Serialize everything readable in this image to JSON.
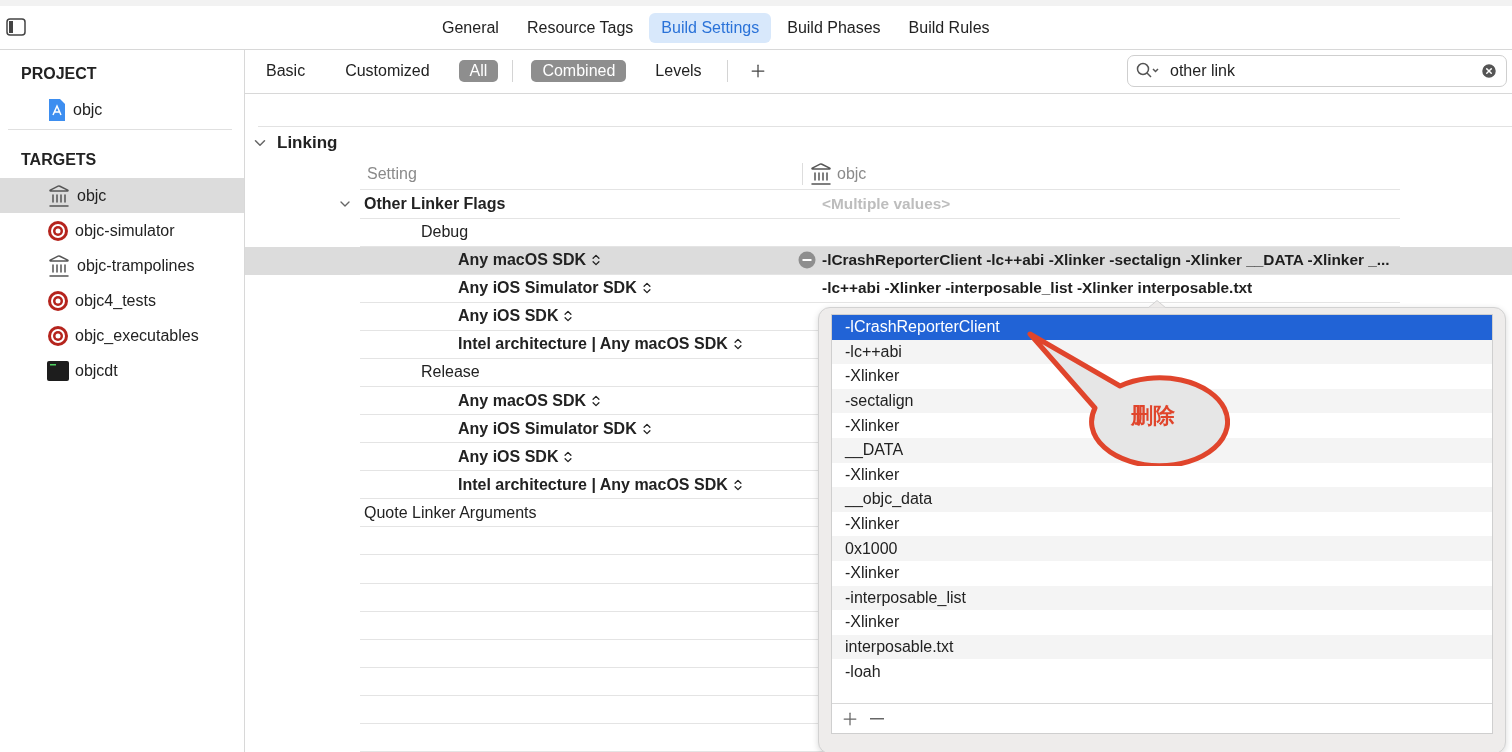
{
  "toolbar": {
    "tabs": [
      {
        "label": "General",
        "selected": false
      },
      {
        "label": "Resource Tags",
        "selected": false
      },
      {
        "label": "Build Settings",
        "selected": true
      },
      {
        "label": "Build Phases",
        "selected": false
      },
      {
        "label": "Build Rules",
        "selected": false
      }
    ]
  },
  "sidebar": {
    "sections": [
      {
        "title": "PROJECT",
        "items": [
          {
            "label": "objc",
            "kind": "project",
            "selected": false
          }
        ]
      },
      {
        "title": "TARGETS",
        "items": [
          {
            "label": "objc",
            "kind": "library",
            "selected": true
          },
          {
            "label": "objc-simulator",
            "kind": "target",
            "selected": false
          },
          {
            "label": "objc-trampolines",
            "kind": "library",
            "selected": false
          },
          {
            "label": "objc4_tests",
            "kind": "target",
            "selected": false
          },
          {
            "label": "objc_executables",
            "kind": "target",
            "selected": false
          },
          {
            "label": "objcdt",
            "kind": "tool",
            "selected": false
          }
        ]
      }
    ]
  },
  "filter_bar": {
    "scopes": [
      {
        "label": "Basic",
        "selected": false
      },
      {
        "label": "Customized",
        "selected": false
      },
      {
        "label": "All",
        "selected": true
      }
    ],
    "views": [
      {
        "label": "Combined",
        "selected": true
      },
      {
        "label": "Levels",
        "selected": false
      }
    ],
    "search": {
      "value": "other link"
    }
  },
  "settings": {
    "section": "Linking",
    "expanded": true,
    "columns": [
      "Setting",
      "objc"
    ],
    "rows": [
      {
        "kind": "setting",
        "name": "Other Linker Flags",
        "expanded": true,
        "value": "<Multiple values>",
        "selected": false
      },
      {
        "kind": "config",
        "name": "Debug",
        "selected": false
      },
      {
        "kind": "condition",
        "name": "Any macOS SDK",
        "value": "-lCrashReporterClient -lc++abi -Xlinker -sectalign -Xlinker __DATA -Xlinker _...",
        "selected": true
      },
      {
        "kind": "condition",
        "name": "Any iOS Simulator SDK",
        "value": "-lc++abi -Xlinker -interposable_list -Xlinker interposable.txt",
        "selected": false
      },
      {
        "kind": "condition",
        "name": "Any iOS SDK",
        "selected": false
      },
      {
        "kind": "condition",
        "name": "Intel architecture | Any macOS SDK",
        "selected": false
      },
      {
        "kind": "config",
        "name": "Release",
        "selected": false
      },
      {
        "kind": "condition",
        "name": "Any macOS SDK",
        "selected": false
      },
      {
        "kind": "condition",
        "name": "Any iOS Simulator SDK",
        "selected": false
      },
      {
        "kind": "condition",
        "name": "Any iOS SDK",
        "selected": false
      },
      {
        "kind": "condition",
        "name": "Intel architecture | Any macOS SDK",
        "selected": false
      },
      {
        "kind": "plain",
        "name": "Quote Linker Arguments",
        "selected": false
      }
    ]
  },
  "value_popup": {
    "items": [
      {
        "label": "-lCrashReporterClient",
        "selected": true
      },
      {
        "label": "-lc++abi",
        "selected": false
      },
      {
        "label": "-Xlinker",
        "selected": false
      },
      {
        "label": "-sectalign",
        "selected": false
      },
      {
        "label": "-Xlinker",
        "selected": false
      },
      {
        "label": "__DATA",
        "selected": false
      },
      {
        "label": "-Xlinker",
        "selected": false
      },
      {
        "label": "__objc_data",
        "selected": false
      },
      {
        "label": "-Xlinker",
        "selected": false
      },
      {
        "label": "0x1000",
        "selected": false
      },
      {
        "label": "-Xlinker",
        "selected": false
      },
      {
        "label": "-interposable_list",
        "selected": false
      },
      {
        "label": "-Xlinker",
        "selected": false
      },
      {
        "label": "interposable.txt",
        "selected": false
      },
      {
        "label": "-loah",
        "selected": false
      }
    ]
  },
  "annotation": {
    "text": "删除"
  }
}
